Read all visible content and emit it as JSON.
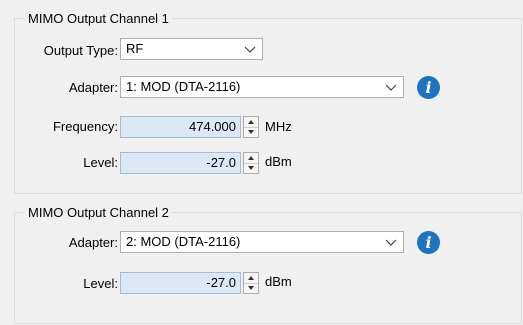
{
  "channel1": {
    "title": "MIMO Output Channel 1",
    "output_type": {
      "label": "Output Type:",
      "value": "RF"
    },
    "adapter": {
      "label": "Adapter:",
      "value": "1: MOD (DTA-2116)"
    },
    "frequency": {
      "label": "Frequency:",
      "value": "474.000",
      "unit": "MHz"
    },
    "level": {
      "label": "Level:",
      "value": "-27.0",
      "unit": "dBm"
    }
  },
  "channel2": {
    "title": "MIMO Output Channel 2",
    "adapter": {
      "label": "Adapter:",
      "value": "2: MOD (DTA-2116)"
    },
    "level": {
      "label": "Level:",
      "value": "-27.0",
      "unit": "dBm"
    }
  },
  "info_glyph": "i",
  "colors": {
    "info_icon": "#1e73be",
    "numeric_field_bg": "#dde8f6"
  }
}
